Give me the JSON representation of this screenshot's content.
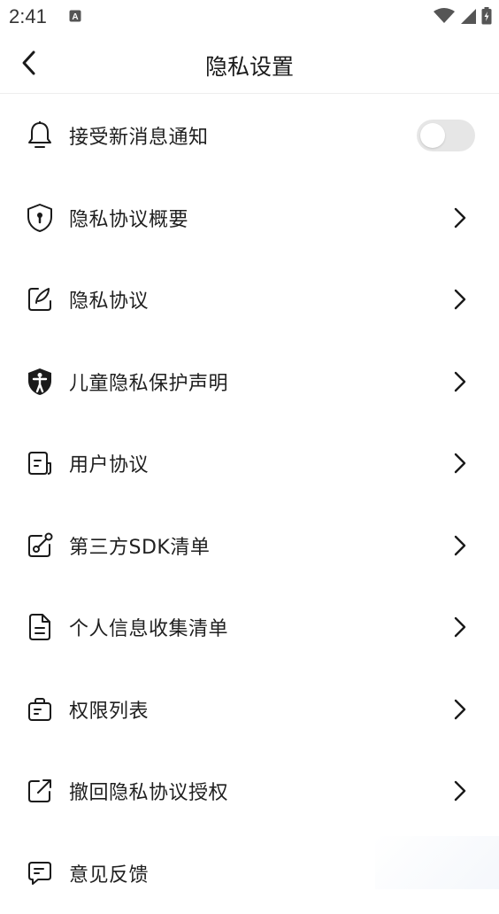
{
  "status_bar": {
    "time": "2:41"
  },
  "header": {
    "title": "隐私设置"
  },
  "items": [
    {
      "label": "接受新消息通知",
      "icon": "bell-icon",
      "control": "toggle",
      "toggle_on": false
    },
    {
      "label": "隐私协议概要",
      "icon": "shield-key-icon",
      "control": "chevron"
    },
    {
      "label": "隐私协议",
      "icon": "edit-note-icon",
      "control": "chevron"
    },
    {
      "label": "儿童隐私保护声明",
      "icon": "child-shield-icon",
      "control": "chevron"
    },
    {
      "label": "用户协议",
      "icon": "document-icon",
      "control": "chevron"
    },
    {
      "label": "第三方SDK清单",
      "icon": "link-share-icon",
      "control": "chevron"
    },
    {
      "label": "个人信息收集清单",
      "icon": "file-list-icon",
      "control": "chevron"
    },
    {
      "label": "权限列表",
      "icon": "briefcase-icon",
      "control": "chevron"
    },
    {
      "label": "撤回隐私协议授权",
      "icon": "external-link-icon",
      "control": "chevron"
    },
    {
      "label": "意见反馈",
      "icon": "feedback-chat-icon",
      "control": "none"
    }
  ],
  "colors": {
    "text": "#1f1f1f",
    "toggle_off": "#e6e6e6",
    "divider": "#eeeeee"
  }
}
